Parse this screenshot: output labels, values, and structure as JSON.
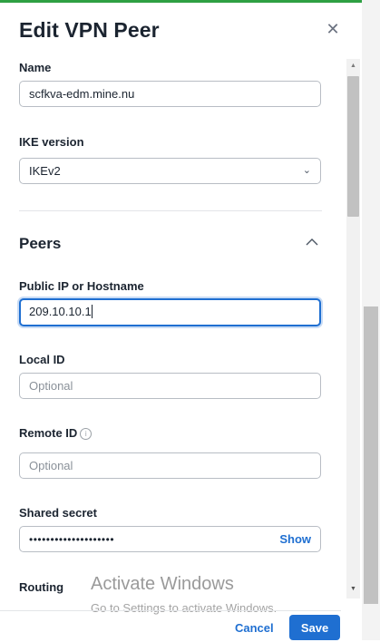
{
  "dialog": {
    "title": "Edit VPN Peer",
    "close_icon": "close-icon"
  },
  "fields": {
    "name": {
      "label": "Name",
      "value": "scfkva-edm.mine.nu"
    },
    "ike_version": {
      "label": "IKE version",
      "value": "IKEv2"
    },
    "peers_section": {
      "title": "Peers",
      "expanded": true
    },
    "public_ip": {
      "label": "Public IP or Hostname",
      "value": "209.10.10.1"
    },
    "local_id": {
      "label": "Local ID",
      "value": "",
      "placeholder": "Optional"
    },
    "remote_id": {
      "label": "Remote ID",
      "value": "",
      "placeholder": "Optional",
      "info_icon": "info-icon"
    },
    "shared_secret": {
      "label": "Shared secret",
      "masked_value": "••••••••••••••••••••",
      "show_label": "Show"
    },
    "routing": {
      "label": "Routing"
    }
  },
  "watermark": {
    "title": "Activate Windows",
    "subtitle": "Go to Settings to activate Windows."
  },
  "footer": {
    "cancel_label": "Cancel",
    "save_label": "Save"
  },
  "colors": {
    "accent": "#1f6fd1",
    "top_bar": "#2ea043"
  }
}
